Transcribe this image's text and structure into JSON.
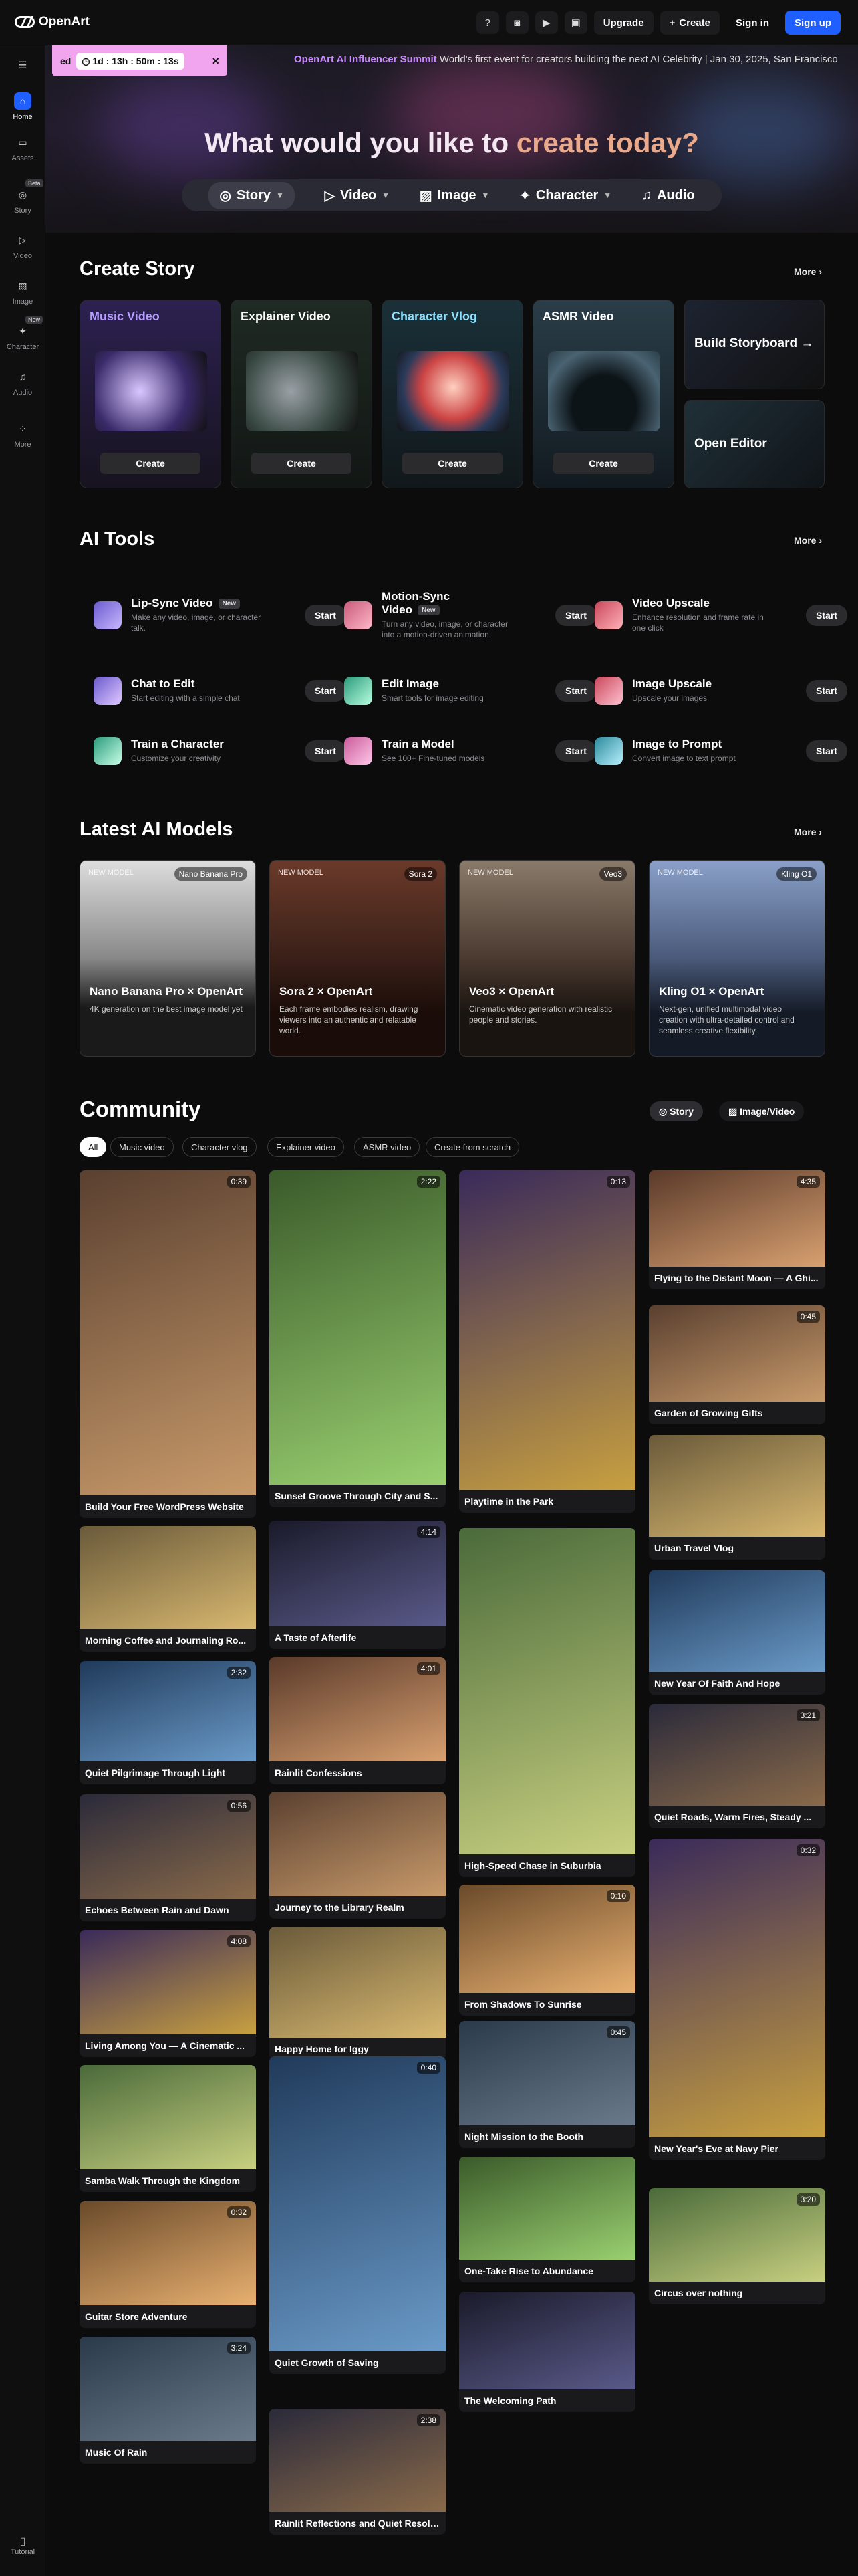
{
  "brand": {
    "name": "OpenArt"
  },
  "topbar": {
    "upgrade": "Upgrade",
    "create": "Create",
    "signin": "Sign in",
    "signup": "Sign up",
    "create_icon": "plus-icon"
  },
  "sidebar": {
    "items": [
      {
        "label": "Home",
        "icon": "home-icon",
        "active": true
      },
      {
        "label": "Assets",
        "icon": "folder-icon"
      },
      {
        "label": "Story",
        "icon": "story-icon",
        "badge": "Beta"
      },
      {
        "label": "Video",
        "icon": "video-icon"
      },
      {
        "label": "Image",
        "icon": "image-icon"
      },
      {
        "label": "Character",
        "icon": "character-icon",
        "badge": "New"
      },
      {
        "label": "Audio",
        "icon": "audio-icon"
      },
      {
        "label": "More",
        "icon": "more-icon"
      }
    ],
    "tutorial": "Tutorial"
  },
  "promo": {
    "prefix": "ed",
    "timer": "1d : 13h : 50m : 13s",
    "summit": "OpenArt AI Influencer Summit",
    "text": "World's first event for creators building the next AI Celebrity | Jan 30, 2025, San Francisco"
  },
  "hero": {
    "title_a": "What would you like to ",
    "title_b": "create today?",
    "tabs": [
      "Story",
      "Video",
      "Image",
      "Character",
      "Audio"
    ]
  },
  "create_story": {
    "title": "Create Story",
    "more": "More",
    "cards": [
      {
        "label": "Music Video",
        "button": "Create",
        "accent": "#8f6bff"
      },
      {
        "label": "Explainer Video",
        "button": "Create",
        "accent": "#ffffff"
      },
      {
        "label": "Character Vlog",
        "button": "Create",
        "accent": "#7fd6ff"
      },
      {
        "label": "ASMR Video",
        "button": "Create",
        "accent": "#ffffff"
      }
    ],
    "aux": [
      "Build Storyboard →",
      "Open Editor"
    ]
  },
  "ai_tools": {
    "title": "AI Tools",
    "more": "More",
    "tools": [
      {
        "name": "Lip-Sync Video",
        "badge": "New",
        "desc": "Make any video, image, or character talk.",
        "start": "Start"
      },
      {
        "name": "Motion-Sync Video",
        "badge": "New",
        "desc": "Turn any video, image, or character into a motion-driven animation.",
        "start": "Start"
      },
      {
        "name": "Video Upscale",
        "badge": "",
        "desc": "Enhance resolution and frame rate in one click",
        "start": "Start"
      },
      {
        "name": "Chat to Edit",
        "badge": "",
        "desc": "Start editing with a simple chat",
        "start": "Start"
      },
      {
        "name": "Edit Image",
        "badge": "",
        "desc": "Smart tools for image editing",
        "start": "Start"
      },
      {
        "name": "Image Upscale",
        "badge": "",
        "desc": "Upscale your images",
        "start": "Start"
      },
      {
        "name": "Train a Character",
        "badge": "",
        "desc": "Customize your creativity",
        "start": "Start"
      },
      {
        "name": "Train a Model",
        "badge": "",
        "desc": "See 100+ Fine-tuned models",
        "start": "Start"
      },
      {
        "name": "Image to Prompt",
        "badge": "",
        "desc": "Convert image to text prompt",
        "start": "Start"
      }
    ]
  },
  "models": {
    "title": "Latest AI Models",
    "more": "More",
    "items": [
      {
        "tag": "NEW MODEL",
        "src": "Nano Banana Pro",
        "name": "Nano Banana Pro × OpenArt",
        "desc": "4K generation on the best image model yet"
      },
      {
        "tag": "NEW MODEL",
        "src": "Sora 2",
        "name": "Sora 2 × OpenArt",
        "desc": "Each frame embodies realism, drawing viewers into an authentic and relatable world."
      },
      {
        "tag": "NEW MODEL",
        "src": "Veo3",
        "name": "Veo3 × OpenArt",
        "desc": "Cinematic video generation with realistic people and stories."
      },
      {
        "tag": "NEW MODEL",
        "src": "Kling O1",
        "name": "Kling O1 × OpenArt",
        "desc": "Next-gen, unified multimodal video creation with ultra-detailed control and seamless creative flexibility."
      }
    ]
  },
  "community": {
    "title": "Community",
    "segments": [
      "Story",
      "Image/Video"
    ],
    "filters": [
      "All",
      "Music video",
      "Character vlog",
      "Explainer video",
      "ASMR video",
      "Create from scratch"
    ],
    "col1": [
      {
        "t": "Build Your Free WordPress Website",
        "d": "0:39"
      },
      {
        "t": "Morning Coffee and Journaling Ro...",
        "d": ""
      },
      {
        "t": "Quiet Pilgrimage Through Light",
        "d": "2:32"
      },
      {
        "t": "Echoes Between Rain and Dawn",
        "d": "0:56"
      },
      {
        "t": "Living Among You — A Cinematic ...",
        "d": "4:08"
      },
      {
        "t": "Samba Walk Through the Kingdom",
        "d": ""
      },
      {
        "t": "Guitar Store Adventure",
        "d": "0:32"
      },
      {
        "t": "Music Of Rain",
        "d": "3:24"
      }
    ],
    "col2": [
      {
        "t": "Sunset Groove Through City and S...",
        "d": "2:22"
      },
      {
        "t": "A Taste of Afterlife",
        "d": "4:14"
      },
      {
        "t": "Rainlit Confessions",
        "d": "4:01"
      },
      {
        "t": "Journey to the Library Realm",
        "d": ""
      },
      {
        "t": "Happy Home for Iggy",
        "d": ""
      },
      {
        "t": "Quiet Growth of Saving",
        "d": "0:40"
      },
      {
        "t": "Rainlit Reflections and Quiet Resolve",
        "d": "2:38"
      }
    ],
    "col3": [
      {
        "t": "Playtime in the Park",
        "d": "0:13"
      },
      {
        "t": "High-Speed Chase in Suburbia",
        "d": ""
      },
      {
        "t": "From Shadows To Sunrise",
        "d": "0:10"
      },
      {
        "t": "Night Mission to the Booth",
        "d": "0:45"
      },
      {
        "t": "One-Take Rise to Abundance",
        "d": ""
      },
      {
        "t": "The Welcoming Path",
        "d": ""
      }
    ],
    "col4": [
      {
        "t": "Flying to the Distant Moon — A Ghi...",
        "d": "4:35"
      },
      {
        "t": "Garden of Growing Gifts",
        "d": "0:45"
      },
      {
        "t": "Urban Travel Vlog",
        "d": ""
      },
      {
        "t": "New Year Of Faith And Hope",
        "d": ""
      },
      {
        "t": "Quiet Roads, Warm Fires, Steady ...",
        "d": "3:21"
      },
      {
        "t": "New Year's Eve at Navy Pier",
        "d": "0:32"
      },
      {
        "t": "Circus over nothing",
        "d": "3:20"
      }
    ]
  }
}
